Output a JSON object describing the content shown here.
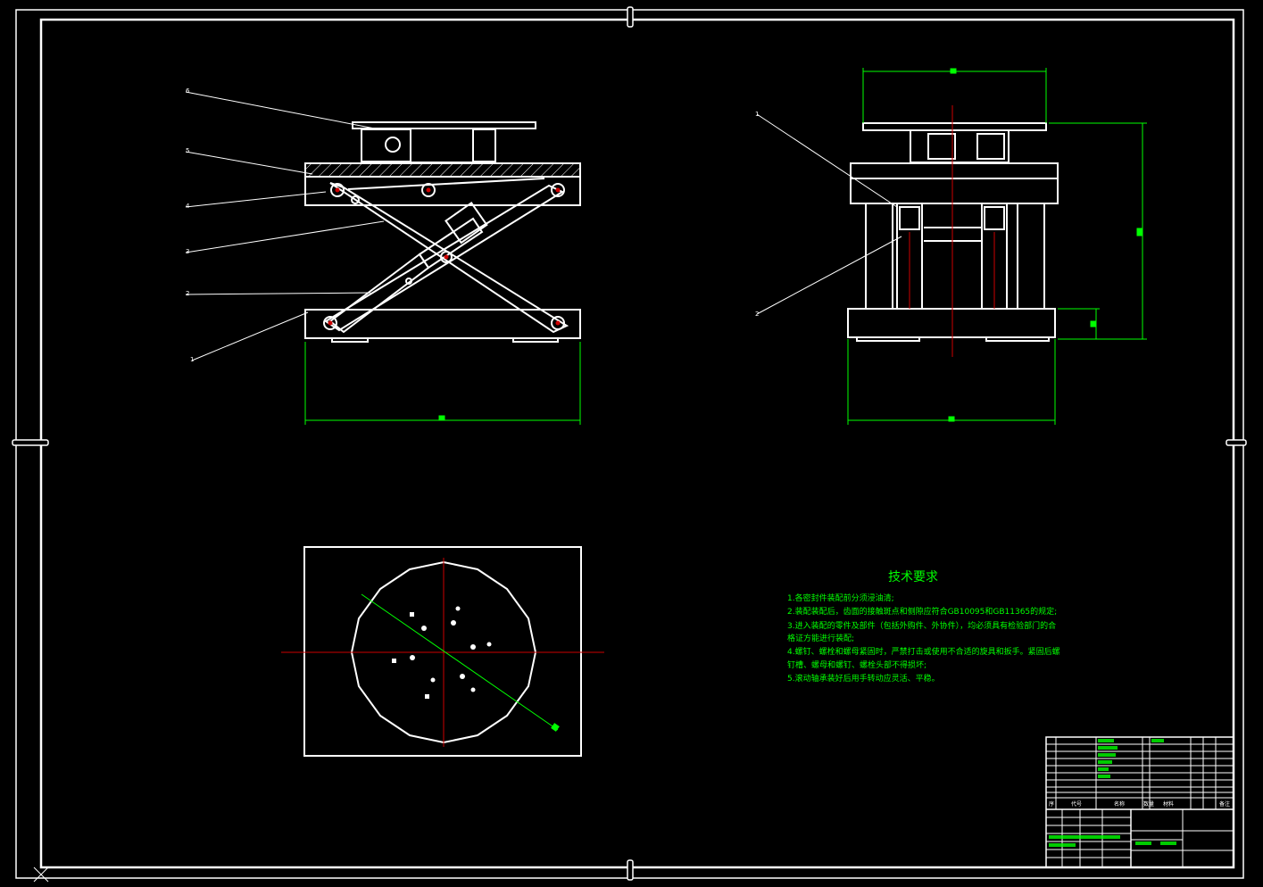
{
  "colors": {
    "background": "#000000",
    "outline": "#ffffff",
    "dimension": "#00ff00",
    "centerline": "#ff0000",
    "text": "#00ff00"
  },
  "part_labels": [
    "6",
    "5",
    "4",
    "3",
    "2",
    "1"
  ],
  "right_view_labels": [
    "1",
    "2"
  ],
  "technical_requirements": {
    "title": "技术要求",
    "lines": [
      "1.各密封件装配前分须浸油清;",
      "2.装配装配后，齿面的接触斑点和侧隙应符合GB10095和GB11365的规定;",
      "3.进入装配的零件及部件（包括外购件、外协件），均必须具有检验部门的合",
      "格证方能进行装配;",
      "4.螺钉、螺栓和螺母紧固时，严禁打击或使用不合适的旋具和扳手。紧固后螺",
      "钉槽、螺母和螺钉、螺栓头部不得损坏;",
      "5.滚动轴承装好后用手转动应灵活、平稳。"
    ]
  },
  "title_block": {
    "header_cells": [
      "序",
      "代号",
      "名称",
      "数量",
      "材料",
      "备注"
    ]
  }
}
